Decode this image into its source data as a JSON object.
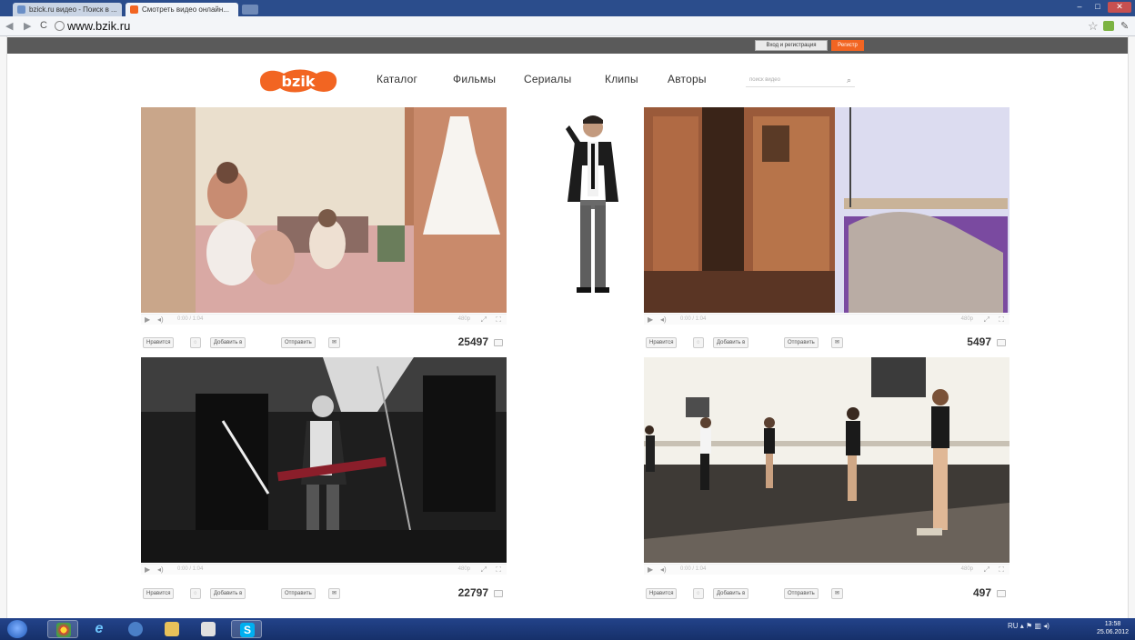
{
  "browser": {
    "tabs": [
      {
        "title": "bzick.ru видео - Поиск в ..."
      },
      {
        "title": "Смотреть видео онлайн..."
      }
    ],
    "address": "www.bzik.ru"
  },
  "sitebar": {
    "login_label": "Вход и регистрация",
    "register_label": "Регистр"
  },
  "header": {
    "logo_alt": "bzik",
    "nav": [
      "Каталог",
      "Фильмы",
      "Сериалы",
      "Клипы",
      "Авторы"
    ],
    "search_placeholder": "поиск видео"
  },
  "videos": [
    {
      "time": "0:00 / 1:04",
      "quality": "480p",
      "like_label": "Нравится",
      "add_label": "Добавить в",
      "send_label": "Отправить",
      "count": "25497"
    },
    {
      "time": "0:00 / 1:04",
      "quality": "480p",
      "like_label": "Нравится",
      "add_label": "Добавить в",
      "send_label": "Отправить",
      "count": "5497"
    },
    {
      "time": "0:00 / 1:04",
      "quality": "480p",
      "like_label": "Нравится",
      "add_label": "Добавить в",
      "send_label": "Отправить",
      "count": "22797"
    },
    {
      "time": "0:00 / 1:04",
      "quality": "480p",
      "like_label": "Нравится",
      "add_label": "Добавить в",
      "send_label": "Отправить",
      "count": "497"
    }
  ],
  "taskbar": {
    "clock_time": "13:58",
    "clock_date": "25.06.2012",
    "tray_lang": "RU"
  },
  "colors": {
    "accent": "#f26522",
    "sitebar": "#5a5a5a",
    "taskbar": "#1d3a7a"
  }
}
